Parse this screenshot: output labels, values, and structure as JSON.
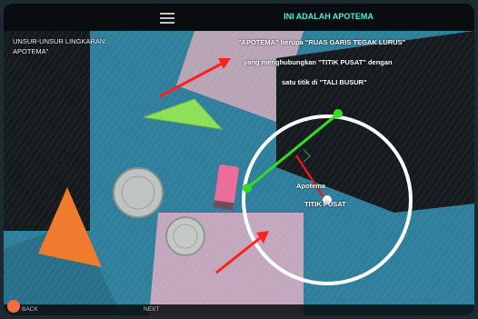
{
  "header": {
    "menu_icon": "hamburger-menu-icon",
    "title": "INI ADALAH APOTEMA"
  },
  "lesson": {
    "section_label": "UNSUR-UNSUR LINGKARAN:\nAPOTEMA\"",
    "description_line1": "\"APOTEMA\" berupa \"RUAS GARIS TEGAK LURUS\"",
    "description_line2": "yang menghubungkan \"TITIK PUSAT\" dengan",
    "description_line3": "satu titik di \"TALI BUSUR\""
  },
  "diagram": {
    "apotema_label": "Apotema",
    "center_label": "TITIK PUSAT",
    "colors": {
      "circle": "#ffffff",
      "chord": "#33dd22",
      "apotema": "#e21b1b",
      "arrow": "#ff2020"
    }
  },
  "footer": {
    "back_label": "BACK",
    "next_label": "NEXT"
  },
  "colors": {
    "title": "#49f0d8",
    "topbar": "#0a0d10"
  }
}
